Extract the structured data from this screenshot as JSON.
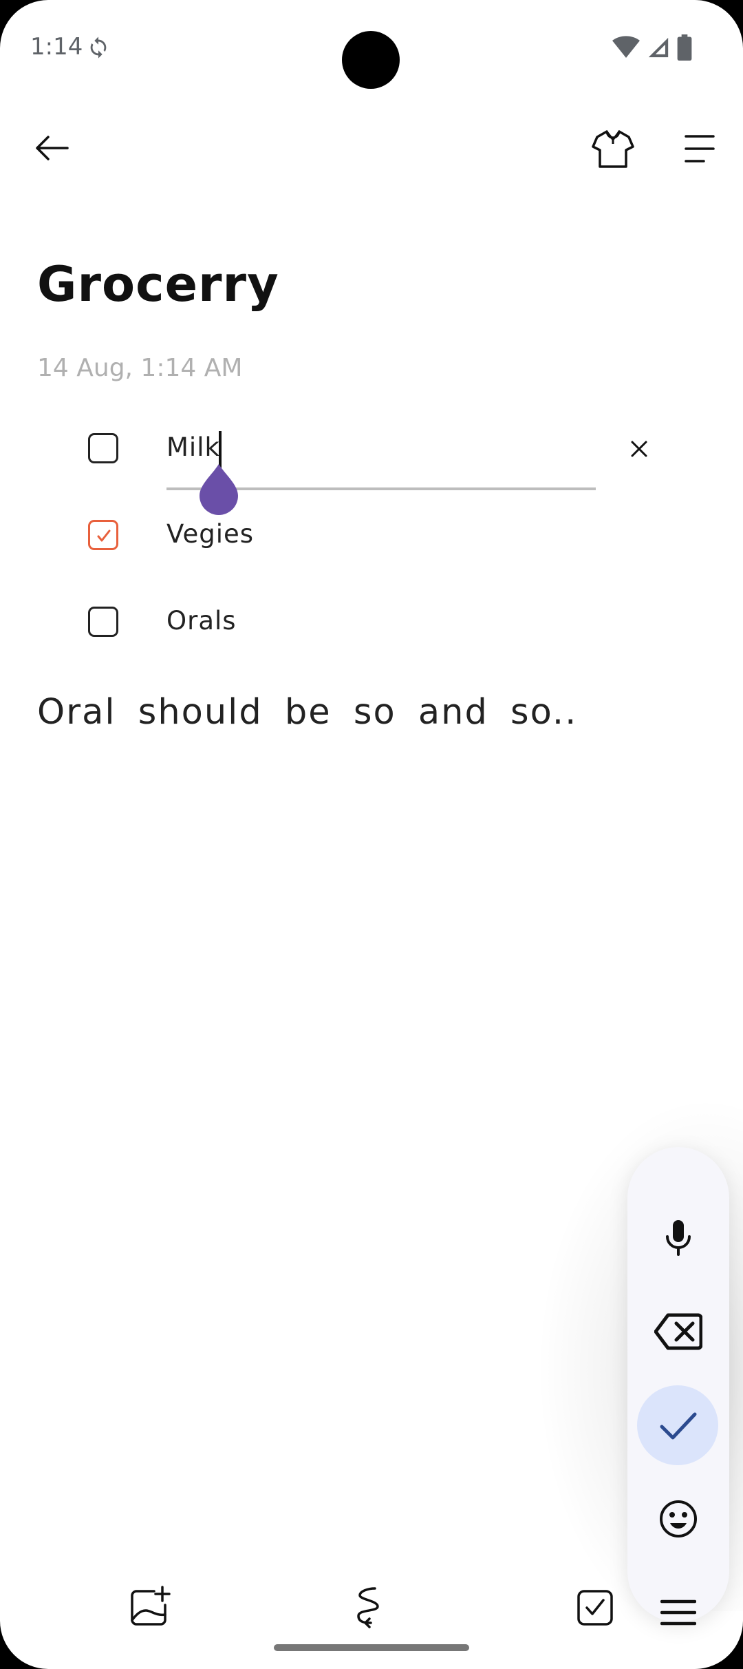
{
  "status_bar": {
    "time": "1:14",
    "icons": [
      "sync-icon",
      "wifi-icon",
      "signal-icon",
      "battery-icon"
    ]
  },
  "app_bar": {
    "icons": [
      "back-arrow-icon",
      "shirt-theme-icon",
      "menu-lines-icon"
    ]
  },
  "note": {
    "title": "Grocerry",
    "timestamp": "14 Aug, 1:14  AM",
    "checklist": [
      {
        "label": "Milk",
        "checked": false,
        "editing": true
      },
      {
        "label": "Vegies",
        "checked": true,
        "editing": false
      },
      {
        "label": "Orals",
        "checked": false,
        "editing": false
      }
    ],
    "body": "Oral  should  be  so  and  so.."
  },
  "keyboard_toolbar": {
    "buttons": [
      "mic-icon",
      "backspace-icon",
      "check-icon",
      "emoji-icon",
      "menu-icon"
    ],
    "active": "check-icon"
  },
  "bottom_toolbar": {
    "buttons": [
      "add-image-icon",
      "draw-icon",
      "checklist-icon"
    ]
  },
  "colors": {
    "accent_orange": "#e8603c",
    "handle_purple": "#6a4fa8",
    "active_blue": "#dbe4fb"
  }
}
